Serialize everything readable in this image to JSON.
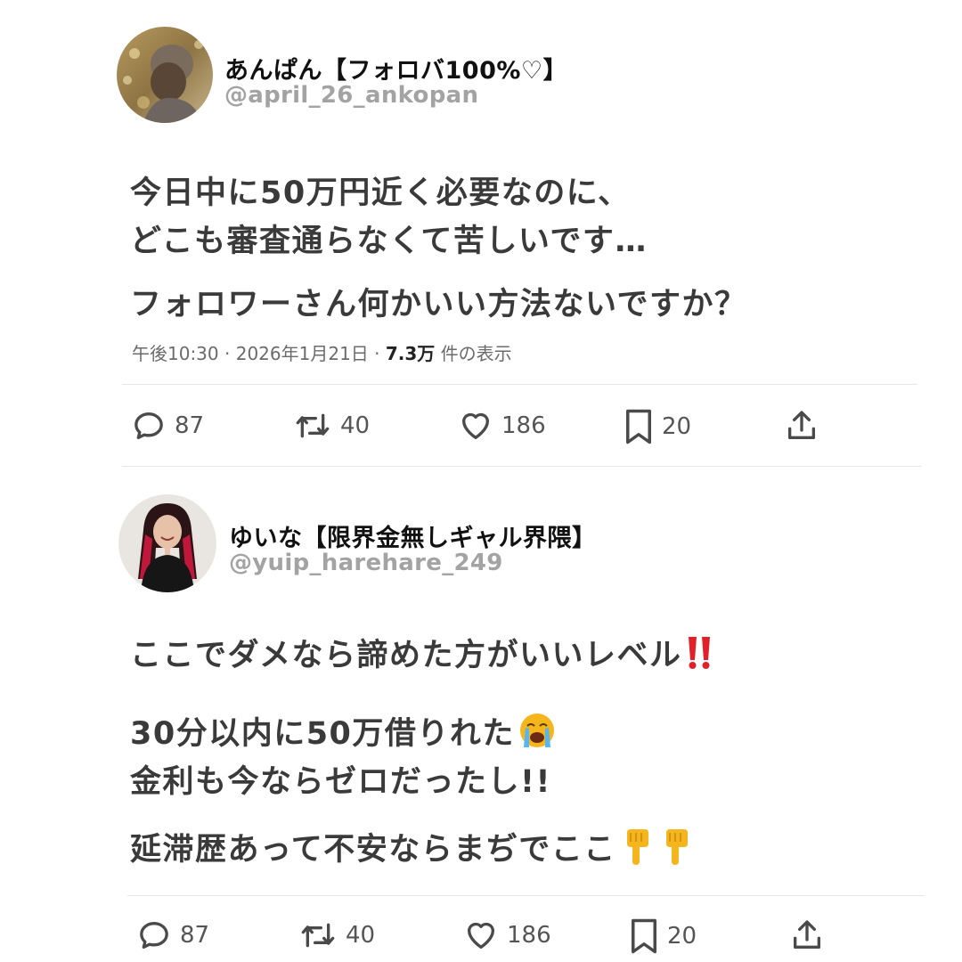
{
  "tweets": [
    {
      "display_name": "あんぱん【フォロバ100%♡】",
      "handle": "@april_26_ankopan",
      "lines": [
        "今日中に50万円近く必要なのに、",
        "どこも審査通らなくて苦しいです…",
        "フォロワーさん何かいい方法ないですか？"
      ],
      "meta": {
        "time": "午後10:30",
        "date": "2026年1月21日",
        "views": "7.3万",
        "views_suffix": "件の表示"
      },
      "actions": {
        "replies": "87",
        "retweets": "40",
        "likes": "186",
        "bookmarks": "20"
      }
    },
    {
      "display_name": "ゆいな【限界金無しギャル界隈】",
      "handle": "@yuip_harehare_249",
      "lines": [
        "ここでダメなら諦めた方がいいレベル",
        "30分以内に50万借りれた",
        "金利も今ならゼロだったし!!",
        "延滞歴あって不安ならまぢでここ"
      ],
      "emojis": {
        "line1": "double-exclamation-icon",
        "line2": "loudly-crying-face-icon",
        "line4": "pointing-down-hand-icon"
      },
      "actions": {
        "replies": "87",
        "retweets": "40",
        "likes": "186",
        "bookmarks": "20"
      }
    }
  ],
  "colors": {
    "text": "#3a3a3a",
    "handle": "#a3a3a3",
    "icon": "#4a4a4a",
    "divider": "#e6e6e6",
    "emoji_red": "#e0202a",
    "emoji_yellow": "#f5b51c"
  }
}
